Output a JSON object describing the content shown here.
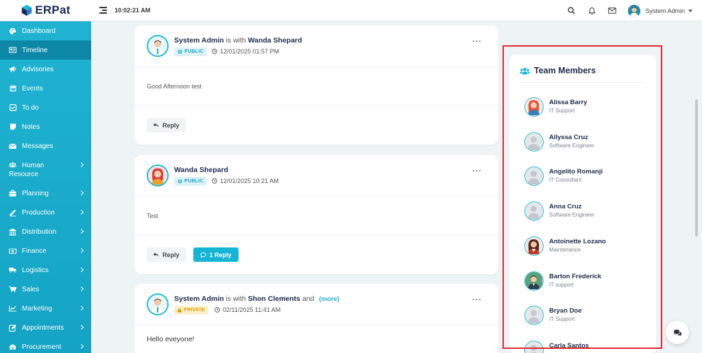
{
  "app": {
    "logo_text": "ERPat",
    "clock": "10:02:21 AM",
    "user_name": "System Admin"
  },
  "sidebar": {
    "items": [
      {
        "label": "Dashboard",
        "icon": "palette-icon",
        "has_children": false,
        "active": false
      },
      {
        "label": "Timeline",
        "icon": "newspaper-icon",
        "has_children": false,
        "active": true
      },
      {
        "label": "Advisories",
        "icon": "megaphone-icon",
        "has_children": false,
        "active": false
      },
      {
        "label": "Events",
        "icon": "calendar-icon",
        "has_children": false,
        "active": false
      },
      {
        "label": "To do",
        "icon": "checkbox-icon",
        "has_children": false,
        "active": false
      },
      {
        "label": "Notes",
        "icon": "sticky-note-icon",
        "has_children": false,
        "active": false
      },
      {
        "label": "Messages",
        "icon": "envelope-icon",
        "has_children": false,
        "active": false
      },
      {
        "label": "Human Resource",
        "icon": "users-icon",
        "has_children": true,
        "active": false
      },
      {
        "label": "Planning",
        "icon": "briefcase-icon",
        "has_children": true,
        "active": false
      },
      {
        "label": "Production",
        "icon": "flask-icon",
        "has_children": true,
        "active": false
      },
      {
        "label": "Distribution",
        "icon": "bank-icon",
        "has_children": true,
        "active": false
      },
      {
        "label": "Finance",
        "icon": "money-icon",
        "has_children": true,
        "active": false
      },
      {
        "label": "Logistics",
        "icon": "truck-icon",
        "has_children": true,
        "active": false
      },
      {
        "label": "Sales",
        "icon": "cart-icon",
        "has_children": true,
        "active": false
      },
      {
        "label": "Marketing",
        "icon": "line-chart-icon",
        "has_children": true,
        "active": false
      },
      {
        "label": "Appointments",
        "icon": "edit-icon",
        "has_children": true,
        "active": false
      },
      {
        "label": "Procurement",
        "icon": "building-icon",
        "has_children": true,
        "active": false
      }
    ]
  },
  "posts": [
    {
      "author": "System Admin",
      "with_text": "is with",
      "with": "Wanda Shepard",
      "and_text": "",
      "more": "",
      "visibility": "PUBLIC",
      "time": "12/01/2025 01:57 PM",
      "body": "Good Afternoon test",
      "reply_label": "Reply",
      "replies_label": ""
    },
    {
      "author": "Wanda Shepard",
      "with_text": "",
      "with": "",
      "and_text": "",
      "more": "",
      "visibility": "PUBLIC",
      "time": "12/01/2025 10:21 AM",
      "body": "Test",
      "reply_label": "Reply",
      "replies_label": "1 Reply"
    },
    {
      "author": "System Admin",
      "with_text": "is with",
      "with": "Shon Clements",
      "and_text": "and",
      "more": "(more)",
      "visibility": "PRIVATE",
      "time": "02/11/2025 11:41 AM",
      "body": "Hello eveyone!",
      "reply_label": "",
      "replies_label": ""
    }
  ],
  "team": {
    "title": "Team Members",
    "members": [
      {
        "name": "Alissa Barry",
        "role": "IT Support",
        "avatar": "female-red"
      },
      {
        "name": "Allyssa Cruz",
        "role": "Software Engineer",
        "avatar": "default"
      },
      {
        "name": "Angelito Romanji",
        "role": "IT Consultant",
        "avatar": "default"
      },
      {
        "name": "Anna Cruz",
        "role": "Software Engineer",
        "avatar": "default"
      },
      {
        "name": "Antoinette Lozano",
        "role": "Maintenance",
        "avatar": "female-dark"
      },
      {
        "name": "Barton Frederick",
        "role": "IT support",
        "avatar": "male-green"
      },
      {
        "name": "Bryan Doe",
        "role": "IT Support",
        "avatar": "default"
      },
      {
        "name": "Carla Santos",
        "role": "",
        "avatar": "default"
      }
    ]
  },
  "colors": {
    "sidebar": "#1aacca",
    "sidebar_active": "#0c88a6",
    "accent": "#17b5d4",
    "highlight_border": "#e0282e"
  }
}
